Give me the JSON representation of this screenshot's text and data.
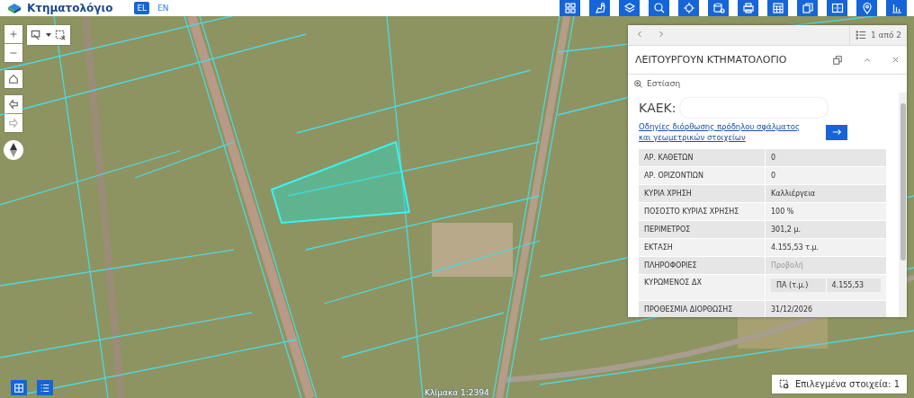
{
  "header": {
    "logo_text": "Κτηματολόγιο",
    "languages": [
      {
        "label": "EL",
        "selected": true
      },
      {
        "label": "EN",
        "selected": false
      }
    ]
  },
  "map": {
    "scale": "Κλίμακα 1:2394"
  },
  "selection_button": {
    "label": "Επιλεγμένα στοιχεία: 1"
  },
  "panel": {
    "pager": "1 από 2",
    "title": "ΛΕΙΤΟΥΡΓΟΥΝ ΚΤΗΜΑΤΟΛΟΓΙΟ",
    "zoom_label": "Εστίαση",
    "kaek_label": "ΚΑΕΚ:",
    "link": "Οδηγίες διόρθωσης πρόδηλου σφάλματος και γεωμετρικών στοιχείων",
    "rows": [
      {
        "kind": "text",
        "label": "ΑΡ. ΚΑΘΕΤΩΝ",
        "value": "0"
      },
      {
        "kind": "text",
        "label": "ΑΡ. ΟΡΙΖΟΝΤΙΩΝ",
        "value": "0"
      },
      {
        "kind": "text",
        "label": "ΚΥΡΙΑ ΧΡΗΣΗ",
        "value": "Καλλιέργεια"
      },
      {
        "kind": "text",
        "label": "ΠΟΣΟΣΤΟ ΚΥΡΙΑΣ ΧΡΗΣΗΣ",
        "value": "100 %"
      },
      {
        "kind": "text",
        "label": "ΠΕΡΙΜΕΤΡΟΣ",
        "value": "301,2 μ."
      },
      {
        "kind": "text",
        "label": "ΕΚΤΑΣΗ",
        "value": "4.155,53 τ.μ."
      },
      {
        "kind": "link",
        "label": "ΠΛΗΡΟΦΟΡΙΕΣ",
        "value": "Προβολή"
      },
      {
        "kind": "subtable",
        "label": "ΚΥΡΩΜΕΝΟΣ ΔΧ",
        "sub_label": "ΠΑ (τ.μ.)",
        "sub_value": "4.155,53"
      },
      {
        "kind": "text",
        "label": "ΠΡΟΘΕΣΜΙΑ ΔΙΟΡΘΩΣΗΣ",
        "value": "31/12/2026"
      }
    ]
  }
}
